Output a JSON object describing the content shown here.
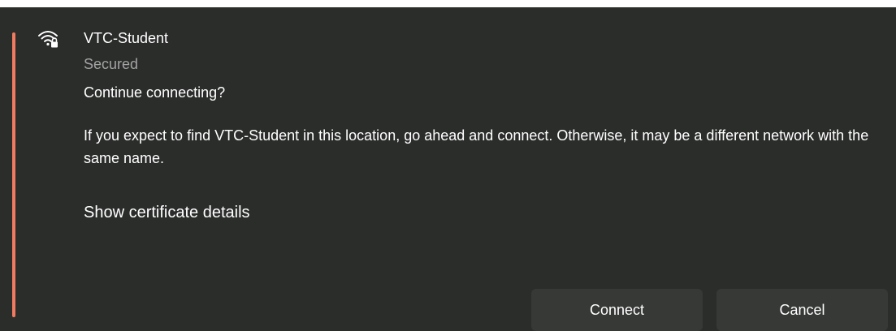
{
  "network": {
    "name": "VTC-Student",
    "status": "Secured",
    "icon": "wifi-secured-icon"
  },
  "prompt": {
    "question": "Continue connecting?",
    "message": "If you expect to find VTC-Student in this location, go ahead and connect. Otherwise, it may be a different network with the same name.",
    "cert_link": "Show certificate details"
  },
  "buttons": {
    "connect_label": "Connect",
    "cancel_label": "Cancel"
  },
  "colors": {
    "accent": "#f07b61",
    "panel": "#2b2d2b",
    "button": "#373937"
  }
}
